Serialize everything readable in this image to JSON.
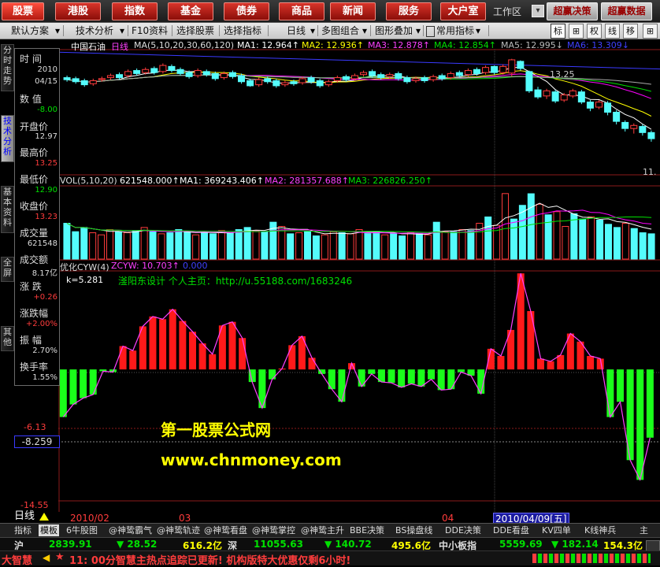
{
  "colors": {
    "up": "#ff3c3c",
    "down": "#54fcfc",
    "yellow": "#ffff00",
    "white": "#ffffff",
    "green": "#00e000",
    "magenta": "#ff00ff",
    "purple": "#ff40ff",
    "osc_up": "#ff1a1a",
    "osc_down": "#1aff1a"
  },
  "top_nav": {
    "items": [
      "股票",
      "港股",
      "指数",
      "基金",
      "债券",
      "商品",
      "新闻",
      "服务",
      "大户室"
    ],
    "active": "股票",
    "workzone": "工作区",
    "right_buttons": [
      "超赢决策",
      "超赢数据"
    ]
  },
  "toolbar": {
    "items": [
      "默认方案",
      "技术分析",
      "F10资料",
      "选择股票",
      "选择指标",
      "日线",
      "多图组合",
      "图形叠加",
      "常用指标"
    ],
    "icons": [
      "标",
      "⊞",
      "权",
      "线",
      "移",
      "⊞"
    ]
  },
  "vtabs": [
    "分时走势",
    "技术分析",
    "基本资料",
    "全屏",
    "其他"
  ],
  "info_panel": {
    "time_label": "时 间",
    "date_year": "2010",
    "date_md": "04/15",
    "value_label": "数 值",
    "value": "-8.00",
    "open_label": "开盘价",
    "open": "12.97",
    "high_label": "最高价",
    "high": "13.25",
    "low_label": "最低价",
    "low": "12.90",
    "close_label": "收盘价",
    "close": "13.23",
    "vol_label": "成交量",
    "vol": "621548",
    "amt_label": "成交额",
    "amt": "8.17亿",
    "chg_label": "涨 跌",
    "chg": "+0.26",
    "pct_label": "涨跌幅",
    "pct": "+2.00%",
    "amp_label": "振 幅",
    "amp": "2.70%",
    "turn_label": "换手率",
    "turn": "1.55%"
  },
  "price_header": {
    "name": "中国石油",
    "period": "日线",
    "ma": "MA(5,10,20,30,60,120)",
    "ma1": "MA1: 12.964↑",
    "ma2": "MA2: 12.936↑",
    "ma3": "MA3: 12.878↑",
    "ma4": "MA4: 12.854↑",
    "ma5": "MA5: 12.995↓",
    "ma6": "MA6: 13.309↓",
    "peak_label": "13.25",
    "low_label": "11.",
    "left_marker": "13.25"
  },
  "vol_header": {
    "title": "VOL(5,10,20)",
    "vol": "621548.000↑",
    "ma1": "MA1: 369243.406↑",
    "ma2": "MA2: 281357.688↑",
    "ma3": "MA3: 226826.250↑"
  },
  "osc_header": {
    "title": "优化CYW(4)",
    "zcyw": "ZCYW: 10.703↑",
    "zero": "0.000",
    "k": "k=5.281",
    "credit": "滏阳东设计 个人主页：http://u.55188.com/1683246",
    "axis_mid": "-6.13",
    "axis_cursor": "-8.259",
    "axis_bottom": "-14.55"
  },
  "watermark": {
    "line1": "第一股票公式网",
    "line2": "www.chnmoney.com"
  },
  "time_axis": {
    "left": "2010/02",
    "mid1": "03",
    "mid2": "04",
    "cursor": "2010/04/09[五]"
  },
  "bottom_tabs": {
    "period": "日线",
    "items": [
      "指标",
      "模板",
      "6牛股图",
      "@神鸷霸气",
      "@神鸷轨迹",
      "@神鸷看盘",
      "@神鸷掌控",
      "@神鸷主升",
      "BBE决策",
      "BS操盘线",
      "DDE决策",
      "DDE看盘",
      "KV四单",
      "K线神兵",
      "主"
    ],
    "active": "模板"
  },
  "index_bar": {
    "sh_label": "沪",
    "sh_val": "2839.91",
    "sh_chg": "▼ 28.52",
    "sh_amt": "616.2亿",
    "sz_label": "深",
    "sz_val": "11055.63",
    "sz_chg": "▼ 140.72",
    "sz_amt": "495.6亿",
    "sme_label": "中小板指",
    "sme_val": "5559.69",
    "sme_chg": "▼ 182.14",
    "sme_amt": "154.3亿"
  },
  "ticker": {
    "brand": "大智慧",
    "text": "11: 00分智慧主热点追踪已更新! 机构版特大优惠仅剩6小时!"
  },
  "chart_data": [
    {
      "type": "candlestick",
      "title": "中国石油 日线",
      "ylim": [
        11.0,
        13.4
      ],
      "candles": [
        {
          "o": 12.88,
          "c": 12.84,
          "h": 12.92,
          "l": 12.8
        },
        {
          "o": 12.86,
          "c": 12.8,
          "h": 12.9,
          "l": 12.76
        },
        {
          "o": 12.82,
          "c": 12.74,
          "h": 12.86,
          "l": 12.7
        },
        {
          "o": 12.76,
          "c": 12.82,
          "h": 12.86,
          "l": 12.72
        },
        {
          "o": 12.84,
          "c": 12.86,
          "h": 12.9,
          "l": 12.8
        },
        {
          "o": 12.88,
          "c": 12.92,
          "h": 12.96,
          "l": 12.84
        },
        {
          "o": 12.94,
          "c": 12.88,
          "h": 12.98,
          "l": 12.84
        },
        {
          "o": 12.92,
          "c": 13.0,
          "h": 13.04,
          "l": 12.88
        },
        {
          "o": 13.02,
          "c": 12.96,
          "h": 13.06,
          "l": 12.92
        },
        {
          "o": 12.98,
          "c": 13.04,
          "h": 13.08,
          "l": 12.94
        },
        {
          "o": 13.06,
          "c": 12.98,
          "h": 13.1,
          "l": 12.94
        },
        {
          "o": 13.0,
          "c": 13.12,
          "h": 13.16,
          "l": 12.96
        },
        {
          "o": 13.1,
          "c": 13.02,
          "h": 13.14,
          "l": 12.98
        },
        {
          "o": 13.04,
          "c": 12.96,
          "h": 13.08,
          "l": 12.92
        },
        {
          "o": 12.98,
          "c": 12.9,
          "h": 13.02,
          "l": 12.86
        },
        {
          "o": 12.92,
          "c": 13.02,
          "h": 13.06,
          "l": 12.88
        },
        {
          "o": 13.0,
          "c": 12.94,
          "h": 13.04,
          "l": 12.9
        },
        {
          "o": 12.96,
          "c": 12.86,
          "h": 13.0,
          "l": 12.82
        },
        {
          "o": 12.88,
          "c": 12.96,
          "h": 13.0,
          "l": 12.84
        },
        {
          "o": 12.98,
          "c": 12.9,
          "h": 13.02,
          "l": 12.86
        },
        {
          "o": 12.92,
          "c": 12.8,
          "h": 12.96,
          "l": 12.76
        },
        {
          "o": 12.82,
          "c": 12.72,
          "h": 12.86,
          "l": 12.7
        },
        {
          "o": 12.74,
          "c": 12.84,
          "h": 12.88,
          "l": 12.7
        },
        {
          "o": 12.86,
          "c": 12.8,
          "h": 12.9,
          "l": 12.76
        },
        {
          "o": 12.82,
          "c": 12.72,
          "h": 12.86,
          "l": 12.68
        },
        {
          "o": 12.74,
          "c": 12.78,
          "h": 12.82,
          "l": 12.7
        },
        {
          "o": 12.8,
          "c": 12.76,
          "h": 12.84,
          "l": 12.72
        },
        {
          "o": 12.78,
          "c": 12.86,
          "h": 12.9,
          "l": 12.74
        },
        {
          "o": 12.88,
          "c": 12.8,
          "h": 12.92,
          "l": 12.76
        },
        {
          "o": 12.82,
          "c": 12.72,
          "h": 12.86,
          "l": 12.68
        },
        {
          "o": 12.74,
          "c": 12.8,
          "h": 12.84,
          "l": 12.7
        },
        {
          "o": 12.82,
          "c": 12.88,
          "h": 12.92,
          "l": 12.78
        },
        {
          "o": 12.9,
          "c": 12.84,
          "h": 12.94,
          "l": 12.8
        },
        {
          "o": 12.86,
          "c": 12.92,
          "h": 12.96,
          "l": 12.82
        },
        {
          "o": 12.94,
          "c": 12.98,
          "h": 13.02,
          "l": 12.9
        },
        {
          "o": 13.0,
          "c": 12.92,
          "h": 13.04,
          "l": 12.88
        },
        {
          "o": 12.94,
          "c": 12.88,
          "h": 12.98,
          "l": 12.84
        },
        {
          "o": 12.9,
          "c": 12.94,
          "h": 12.98,
          "l": 12.86
        },
        {
          "o": 12.96,
          "c": 12.86,
          "h": 13.0,
          "l": 12.82
        },
        {
          "o": 12.88,
          "c": 12.8,
          "h": 12.92,
          "l": 12.76
        },
        {
          "o": 12.82,
          "c": 12.86,
          "h": 12.9,
          "l": 12.78
        },
        {
          "o": 12.88,
          "c": 12.82,
          "h": 12.92,
          "l": 12.78
        },
        {
          "o": 12.84,
          "c": 12.9,
          "h": 12.94,
          "l": 12.8
        },
        {
          "o": 12.92,
          "c": 12.86,
          "h": 12.96,
          "l": 12.82
        },
        {
          "o": 12.88,
          "c": 12.96,
          "h": 13.0,
          "l": 12.84
        },
        {
          "o": 12.98,
          "c": 12.92,
          "h": 13.02,
          "l": 12.88
        },
        {
          "o": 12.94,
          "c": 13.02,
          "h": 13.06,
          "l": 12.9
        },
        {
          "o": 13.04,
          "c": 12.96,
          "h": 13.08,
          "l": 12.92
        },
        {
          "o": 12.98,
          "c": 13.08,
          "h": 13.12,
          "l": 12.94
        },
        {
          "o": 13.1,
          "c": 12.98,
          "h": 13.12,
          "l": 12.94
        },
        {
          "o": 12.98,
          "c": 13.1,
          "h": 13.14,
          "l": 12.94
        },
        {
          "o": 12.97,
          "c": 13.23,
          "h": 13.25,
          "l": 12.9
        },
        {
          "o": 13.2,
          "c": 13.06,
          "h": 13.22,
          "l": 13.02
        },
        {
          "o": 13.0,
          "c": 12.62,
          "h": 13.02,
          "l": 12.58
        },
        {
          "o": 12.64,
          "c": 12.5,
          "h": 12.7,
          "l": 12.46
        },
        {
          "o": 12.52,
          "c": 12.62,
          "h": 12.66,
          "l": 12.46
        },
        {
          "o": 12.6,
          "c": 12.42,
          "h": 12.64,
          "l": 12.38
        },
        {
          "o": 12.44,
          "c": 12.54,
          "h": 12.58,
          "l": 12.4
        },
        {
          "o": 12.52,
          "c": 12.62,
          "h": 12.66,
          "l": 12.48
        },
        {
          "o": 12.6,
          "c": 12.4,
          "h": 12.64,
          "l": 12.36
        },
        {
          "o": 12.4,
          "c": 12.28,
          "h": 12.44,
          "l": 12.22
        },
        {
          "o": 12.3,
          "c": 12.4,
          "h": 12.44,
          "l": 12.26
        },
        {
          "o": 12.38,
          "c": 12.2,
          "h": 12.42,
          "l": 12.14
        },
        {
          "o": 12.2,
          "c": 12.02,
          "h": 12.24,
          "l": 11.96
        },
        {
          "o": 12.0,
          "c": 11.88,
          "h": 12.04,
          "l": 11.82
        },
        {
          "o": 11.88,
          "c": 11.94,
          "h": 11.98,
          "l": 11.78
        },
        {
          "o": 11.92,
          "c": 11.8,
          "h": 11.96,
          "l": 11.74
        },
        {
          "o": 11.8,
          "c": 11.68,
          "h": 11.84,
          "l": 11.62
        }
      ]
    },
    {
      "type": "bar",
      "title": "VOL(5,10,20)",
      "ylim": [
        0,
        680000
      ],
      "values": [
        340000,
        260000,
        300000,
        250000,
        230000,
        280000,
        260000,
        250000,
        270000,
        300000,
        260000,
        240000,
        250000,
        280000,
        260000,
        230000,
        250000,
        240000,
        270000,
        250000,
        280000,
        300000,
        270000,
        260000,
        350000,
        310000,
        240000,
        250000,
        260000,
        220000,
        230000,
        260000,
        250000,
        240000,
        280000,
        250000,
        260000,
        230000,
        240000,
        220000,
        250000,
        240000,
        230000,
        350000,
        260000,
        260000,
        280000,
        270000,
        340000,
        400000,
        320000,
        621548,
        380000,
        510000,
        620000,
        520000,
        420000,
        450000,
        310000,
        430000,
        380000,
        400000,
        370000,
        330000,
        300000,
        340000,
        290000,
        250000,
        240000
      ]
    },
    {
      "type": "bar",
      "title": "优化CYW(4)",
      "ylim": [
        -14.55,
        10.8
      ],
      "values": [
        -5.3,
        -3.9,
        -3.2,
        -2.8,
        -0.2,
        -0.3,
        2.6,
        2.1,
        4.8,
        5.9,
        5.6,
        6.7,
        5.4,
        4.2,
        2.9,
        1.7,
        4.9,
        5.3,
        3.5,
        -1.4,
        -4.3,
        -1.1,
        0.1,
        2.7,
        3.7,
        1.3,
        -0.5,
        -2.2,
        -3.6,
        0.7,
        -1.9,
        -0.5,
        -1.4,
        -1.5,
        -2.0,
        -1.6,
        -1.9,
        -1.1,
        -2.3,
        -2.2,
        -0.3,
        -0.7,
        -2.7,
        2.3,
        1.5,
        4.4,
        10.7,
        6.5,
        1.2,
        0.9,
        1.6,
        4.0,
        3.1,
        1.5,
        1.2,
        -5.3,
        -3.6,
        -10.1,
        -12.3,
        -7.6
      ]
    }
  ]
}
